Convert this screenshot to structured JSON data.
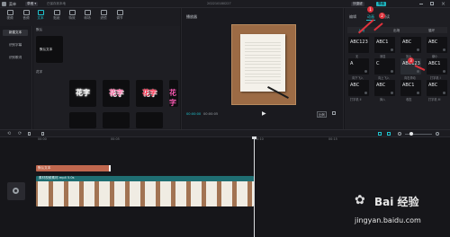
{
  "titlebar": {
    "menu": "菜单",
    "dropdown": "草稿",
    "autosave": "已保存到本地",
    "project": "202210180227",
    "shortcut_btn": "快捷键",
    "export_btn": "导出"
  },
  "toolbar": {
    "items": [
      {
        "label": "视频",
        "icon": "video-icon"
      },
      {
        "label": "音频",
        "icon": "audio-icon"
      },
      {
        "label": "文本",
        "icon": "text-icon"
      },
      {
        "label": "贴纸",
        "icon": "sticker-icon"
      },
      {
        "label": "特效",
        "icon": "effects-icon"
      },
      {
        "label": "转场",
        "icon": "transition-icon"
      },
      {
        "label": "滤镜",
        "icon": "filter-icon"
      },
      {
        "label": "调节",
        "icon": "adjust-icon"
      }
    ]
  },
  "leftnav": {
    "items": [
      "新建文本",
      "识别字幕",
      "识别歌词"
    ]
  },
  "assets": {
    "default_header": "默认",
    "default_tile": "默认文本",
    "flower_header": "花字",
    "flower_text": "花字",
    "flower_colors": [
      "#f0f0f0",
      "#ff6fa8",
      "#ff2e4e",
      "#ff5ab6"
    ]
  },
  "player": {
    "title": "播放器",
    "time_current": "00:00:00",
    "time_total": "00:00:05",
    "ratio": "比例"
  },
  "right": {
    "tabs": [
      "编辑",
      "动画",
      "朗读"
    ],
    "subtabs": [
      "入场",
      "出场",
      "循环"
    ],
    "tiles": [
      {
        "t": "ABC123",
        "label": "无"
      },
      {
        "t": "ABC1",
        "label": "渐显"
      },
      {
        "t": "ABC",
        "label": "放大"
      },
      {
        "t": "ABC",
        "label": "缩小"
      },
      {
        "t": "A",
        "label": "向下飞入"
      },
      {
        "t": "C",
        "label": "向上飞入"
      },
      {
        "t": "ABC123",
        "label": "向右滑动"
      },
      {
        "t": "ABC1",
        "label": "打字机 I"
      },
      {
        "t": "ABC",
        "label": "打字机 II"
      },
      {
        "t": "ABC",
        "label": "弹入"
      },
      {
        "t": "ABC1",
        "label": "收拢"
      },
      {
        "t": "ABC",
        "label": "打字机 III"
      }
    ],
    "badges": [
      "1",
      "2",
      "3"
    ]
  },
  "timeline": {
    "ticks": [
      "00:00",
      "00:05",
      "00:10",
      "00:15"
    ],
    "text_clip": "默认文本",
    "video_clip": "素材视频素材.mp4",
    "video_clip_duration": "5.0s",
    "watermark_text": "Bai 经验",
    "watermark_url": "jingyan.baidu.com"
  }
}
